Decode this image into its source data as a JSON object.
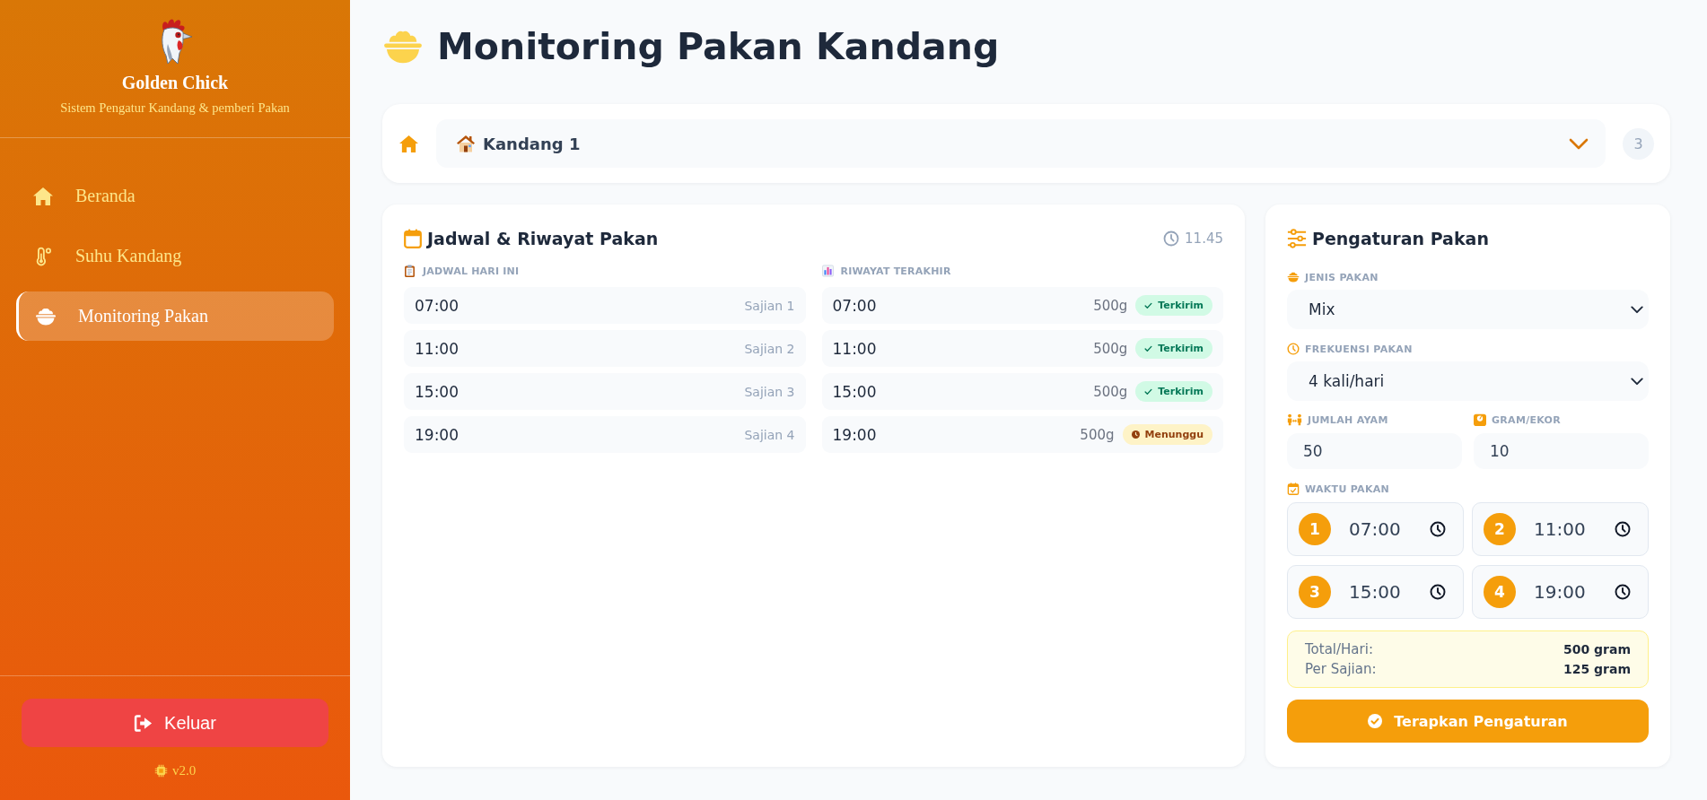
{
  "sidebar": {
    "brand": "Golden Chick",
    "subtitle": "Sistem Pengatur Kandang & pemberi Pakan",
    "items": [
      {
        "label": "Beranda",
        "selected": false
      },
      {
        "label": "Suhu Kandang",
        "selected": false
      },
      {
        "label": "Monitoring Pakan",
        "selected": true
      }
    ],
    "logout_button": "Keluar",
    "version": "v2.0"
  },
  "header": {
    "title": "Monitoring Pakan Kandang"
  },
  "coop_selector": {
    "value": "Kandang 1",
    "count": "3"
  },
  "schedule_card": {
    "title": "Jadwal & Riwayat Pakan",
    "time": "11.45",
    "schedule": {
      "label": "JADWAL HARI INI",
      "rows": [
        {
          "time": "07:00",
          "serving": "Sajian 1"
        },
        {
          "time": "11:00",
          "serving": "Sajian 2"
        },
        {
          "time": "15:00",
          "serving": "Sajian 3"
        },
        {
          "time": "19:00",
          "serving": "Sajian 4"
        }
      ]
    },
    "history": {
      "label": "RIWAYAT TERAKHIR",
      "rows": [
        {
          "time": "07:00",
          "amount": "500g",
          "delivered": true,
          "status": "Terkirim"
        },
        {
          "time": "11:00",
          "amount": "500g",
          "delivered": true,
          "status": "Terkirim"
        },
        {
          "time": "15:00",
          "amount": "500g",
          "delivered": true,
          "status": "Terkirim"
        },
        {
          "time": "19:00",
          "amount": "500g",
          "delivered": false,
          "status": "Menunggu"
        }
      ]
    }
  },
  "settings_card": {
    "title": "Pengaturan Pakan",
    "feed_type": {
      "label": "JENIS PAKAN",
      "value": "Mix"
    },
    "frequency": {
      "label": "FREKUENSI PAKAN",
      "value": "4 kali/hari"
    },
    "chicken_count": {
      "label": "JUMLAH AYAM",
      "value": "50"
    },
    "grams_per_bird": {
      "label": "GRAM/EKOR",
      "value": "10"
    },
    "feed_times": {
      "label": "WAKTU PAKAN",
      "slots": [
        {
          "number": "1",
          "time": "07:00"
        },
        {
          "number": "2",
          "time": "11:00"
        },
        {
          "number": "3",
          "time": "15:00"
        },
        {
          "number": "4",
          "time": "19:00"
        }
      ]
    },
    "summary": [
      {
        "label": "Total/Hari:",
        "value": "500 gram"
      },
      {
        "label": "Per Sajian:",
        "value": "125 gram"
      }
    ],
    "apply_button": "Terapkan Pengaturan"
  }
}
